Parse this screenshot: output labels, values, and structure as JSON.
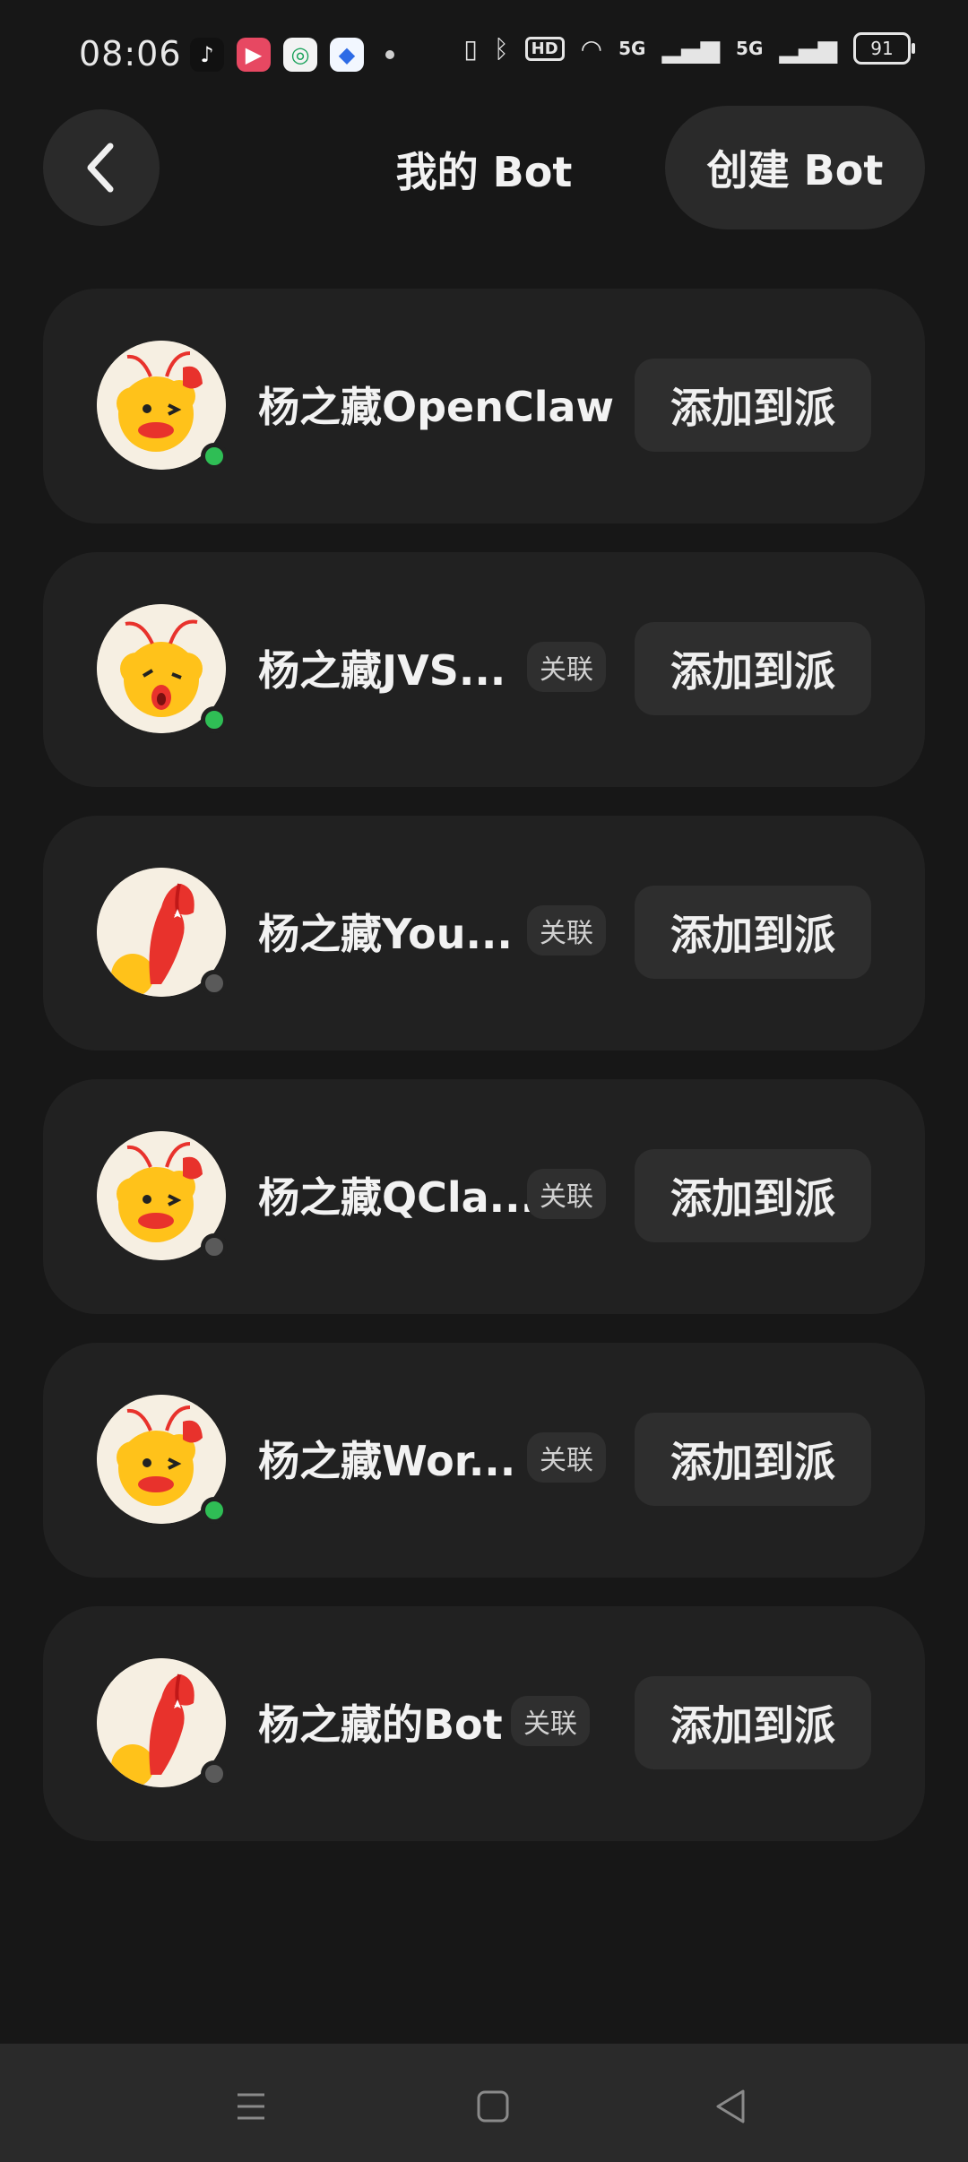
{
  "status_bar": {
    "time": "08:06",
    "battery": "91",
    "network": "5G",
    "hd_label": "HD"
  },
  "header": {
    "title": "我的 Bot",
    "create_label": "创建 Bot"
  },
  "bots": [
    {
      "name": "杨之藏OpenClaw",
      "badge": "",
      "status": "online",
      "avatar": "smiling-mascot",
      "add_label": "添加到派"
    },
    {
      "name": "杨之藏JVS...",
      "badge": "关联",
      "status": "online",
      "avatar": "surprised-mascot",
      "add_label": "添加到派"
    },
    {
      "name": "杨之藏You...",
      "badge": "关联",
      "status": "offline",
      "avatar": "claw-mascot",
      "add_label": "添加到派"
    },
    {
      "name": "杨之藏QCla...",
      "badge": "关联",
      "status": "offline",
      "avatar": "smiling-mascot",
      "add_label": "添加到派"
    },
    {
      "name": "杨之藏Wor...",
      "badge": "关联",
      "status": "online",
      "avatar": "smiling-mascot",
      "add_label": "添加到派"
    },
    {
      "name": "杨之藏的Bot",
      "badge": "关联",
      "status": "offline",
      "avatar": "claw-mascot",
      "add_label": "添加到派"
    }
  ],
  "colors": {
    "background": "#171717",
    "card": "#212121",
    "online": "#2fbe55",
    "offline": "#5a5a5a"
  }
}
